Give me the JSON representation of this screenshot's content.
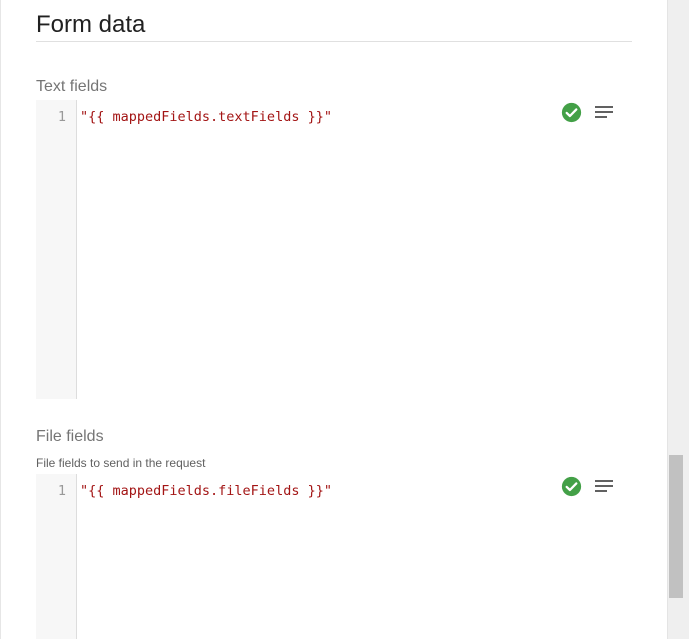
{
  "section": {
    "title": "Form data"
  },
  "text_fields": {
    "label": "Text fields",
    "line_number": "1",
    "code": "\"{{ mappedFields.textFields }}\"",
    "status_icon": "check-circle-icon",
    "format_icon": "format-lines-icon"
  },
  "file_fields": {
    "label": "File fields",
    "help": "File fields to send in the request",
    "line_number": "1",
    "code": "\"{{ mappedFields.fileFields }}\"",
    "status_icon": "check-circle-icon",
    "format_icon": "format-lines-icon"
  },
  "colors": {
    "valid": "#43a047",
    "string": "#a31515",
    "gutter": "#f7f7f7"
  }
}
